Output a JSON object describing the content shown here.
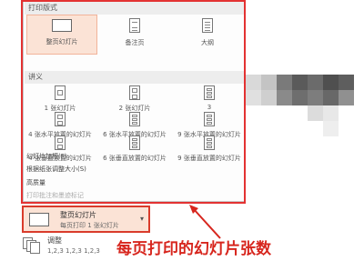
{
  "panel": {
    "print_layout_header": "打印版式",
    "handouts_header": "讲义",
    "layouts": [
      {
        "label": "整页幻灯片"
      },
      {
        "label": "备注页"
      },
      {
        "label": "大纲"
      }
    ],
    "handouts": [
      {
        "label": "1 张幻灯片"
      },
      {
        "label": "2 张幻灯片"
      },
      {
        "label": "3"
      },
      {
        "label": "4 张水平放置的幻灯片"
      },
      {
        "label": "6 张水平放置的幻灯片"
      },
      {
        "label": "9 张水平放置的幻灯片"
      },
      {
        "label": "4 张垂直放置的幻灯片"
      },
      {
        "label": "6 张垂直放置的幻灯片"
      },
      {
        "label": "9 张垂直放置的幻灯片"
      }
    ],
    "options": [
      {
        "label": "幻灯片加框(F)",
        "enabled": true
      },
      {
        "label": "根据纸张调整大小(S)",
        "enabled": true
      },
      {
        "label": "高质量",
        "enabled": true
      },
      {
        "label": "打印批注和墨迹标记",
        "enabled": false
      }
    ]
  },
  "selector": {
    "title": "整页幻灯片",
    "subtitle": "每页打印 1 张幻灯片"
  },
  "collate": {
    "title": "调整",
    "subtitle": "1,2,3    1,2,3    1,2,3"
  },
  "annotation": "每页打印的幻灯片张数",
  "colors": {
    "highlight": "#fbe3d6",
    "annotation_red": "#d7261e"
  }
}
